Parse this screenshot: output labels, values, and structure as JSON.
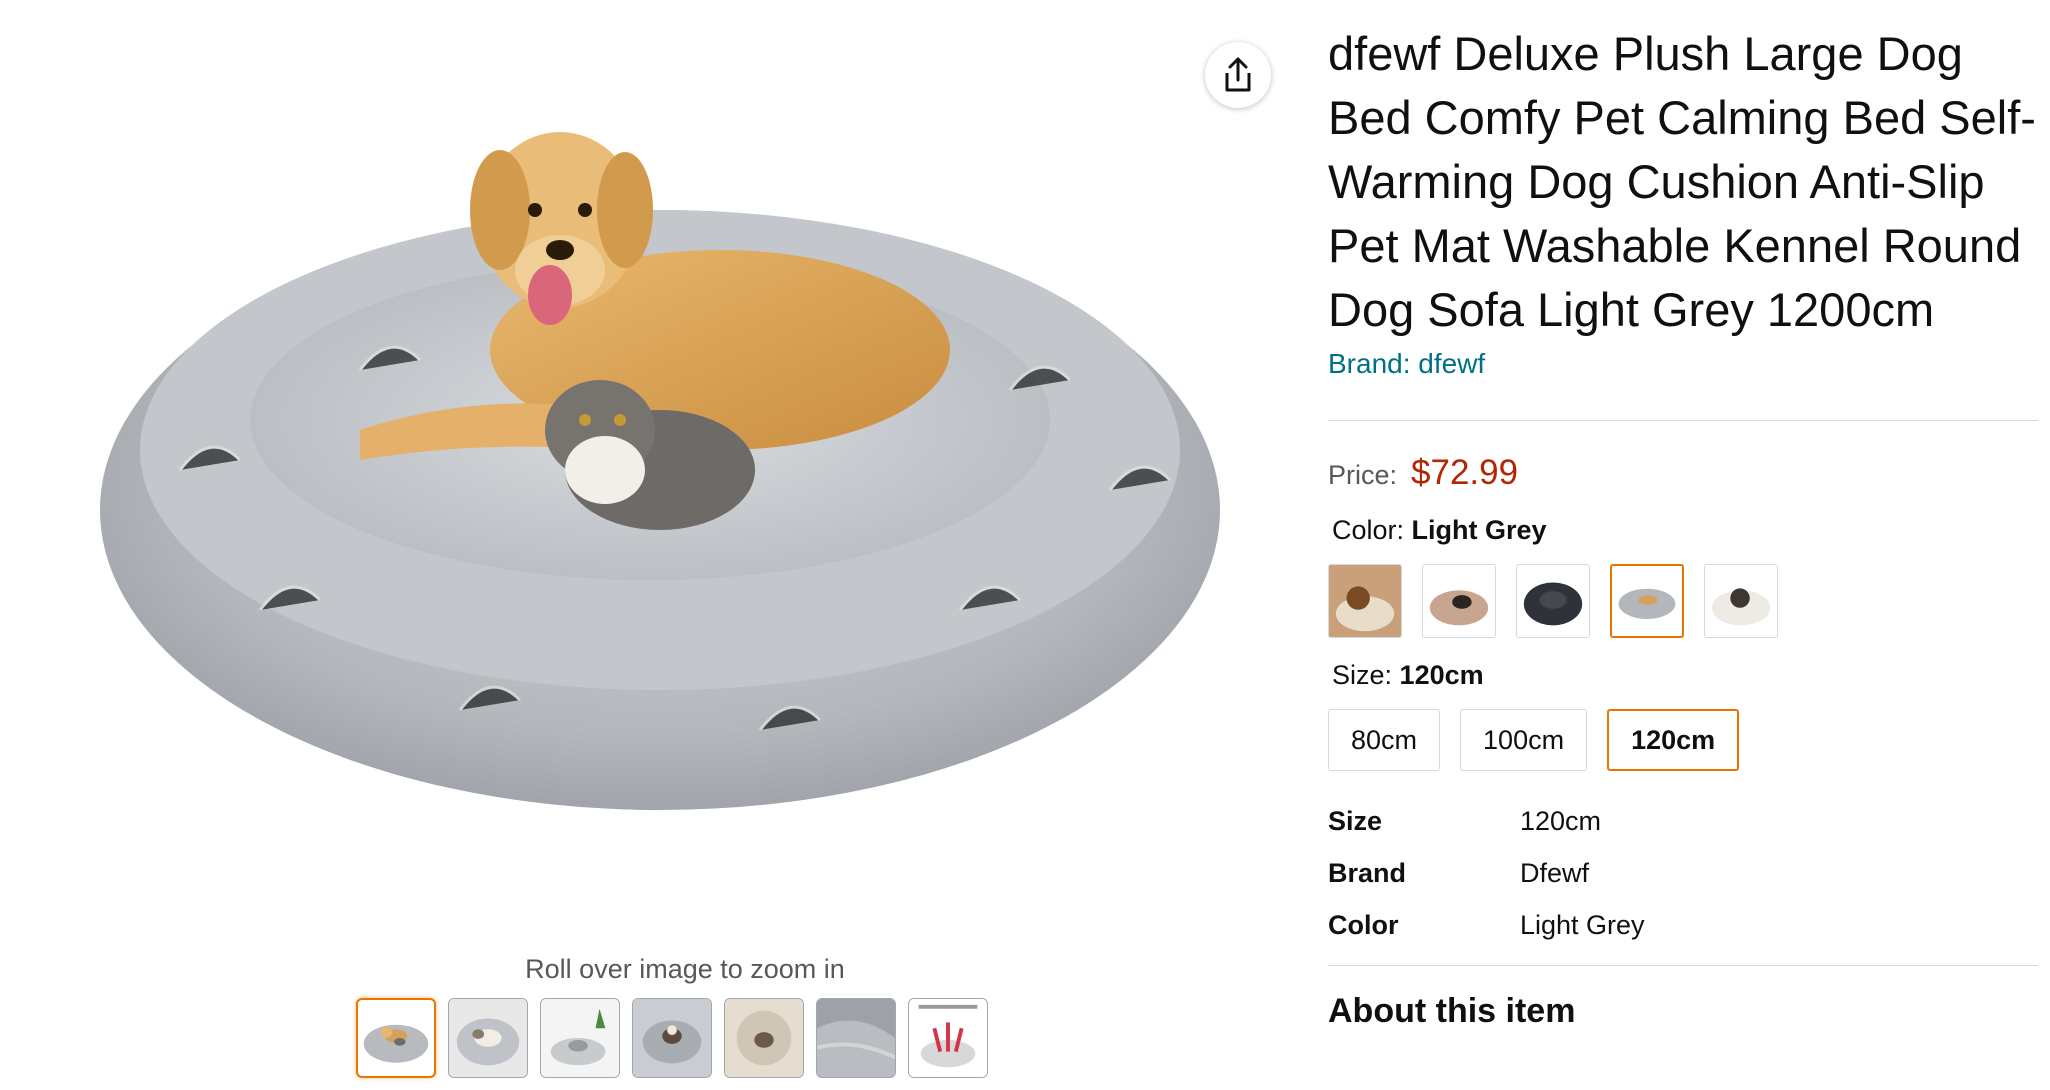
{
  "gallery": {
    "zoom_hint": "Roll over image to zoom in",
    "thumbnails": [
      "thumb-1",
      "thumb-2",
      "thumb-3",
      "thumb-4",
      "thumb-5",
      "thumb-6",
      "thumb-7"
    ],
    "selected_thumbnail": 1,
    "share_icon": "share-icon"
  },
  "product": {
    "title": "dfewf Deluxe Plush Large Dog Bed Comfy Pet Calming Bed Self-Warming Dog Cushion Anti-Slip Pet Mat Washable Kennel Round Dog Sofa Light Grey 1200cm",
    "brand_link": "Brand: dfewf",
    "price_label": "Price:",
    "price": "$72.99",
    "color_label": "Color:",
    "color_value": "Light Grey",
    "size_label": "Size:",
    "size_value": "120cm",
    "colors": [
      "swatch-1",
      "swatch-2",
      "swatch-3",
      "swatch-4",
      "swatch-5"
    ],
    "selected_color": 4,
    "sizes": [
      "80cm",
      "100cm",
      "120cm"
    ],
    "selected_size": "120cm",
    "specs": [
      {
        "key": "Size",
        "value": "120cm"
      },
      {
        "key": "Brand",
        "value": "Dfewf"
      },
      {
        "key": "Color",
        "value": "Light Grey"
      }
    ],
    "about_heading": "About this item"
  },
  "colors": {
    "link": "#007185",
    "price": "#b12704",
    "selected_border": "#e77600"
  }
}
